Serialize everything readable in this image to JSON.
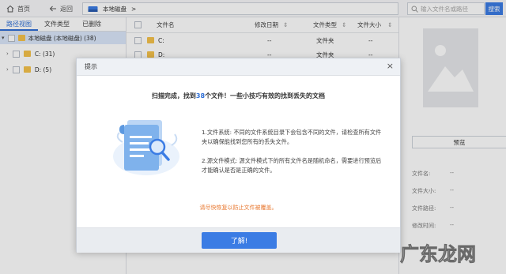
{
  "topbar": {
    "home_label": "首页",
    "back_label": "返回",
    "path": "本地磁盘",
    "path_sep": ">",
    "search_placeholder": "输入文件名或路径",
    "search_button": "搜索"
  },
  "left": {
    "tabs": [
      {
        "label": "路径视图"
      },
      {
        "label": "文件类型"
      },
      {
        "label": "已删除"
      }
    ],
    "tree": [
      {
        "label": "本地磁盘 (本地磁盘) (38)"
      },
      {
        "label": "C: (31)"
      },
      {
        "label": "D: (5)"
      }
    ]
  },
  "filelist": {
    "headers": {
      "name": "文件名",
      "date": "修改日期",
      "type": "文件类型",
      "size": "文件大小"
    },
    "rows": [
      {
        "name": "C:",
        "date": "--",
        "type": "文件夹",
        "size": "--"
      },
      {
        "name": "D:",
        "date": "--",
        "type": "文件夹",
        "size": "--"
      }
    ]
  },
  "right": {
    "preview_button": "预览",
    "fields": [
      {
        "label": "文件名:",
        "value": "--"
      },
      {
        "label": "文件大小:",
        "value": "--"
      },
      {
        "label": "文件路径:",
        "value": "--"
      },
      {
        "label": "修改时间:",
        "value": "--"
      }
    ]
  },
  "dialog": {
    "title": "提示",
    "close": "×",
    "scan_prefix": "扫描完成，找到",
    "scan_count": "38",
    "scan_suffix": "个文件！一些小技巧有效的找到丢失的文档",
    "tip1": "1.文件系统: 不同的文件系统目录下会包含不同的文件，请检查所有文件夹以确保能找到您所有的丢失文件。",
    "tip2": "2.源文件模式: 源文件模式下的所有文件名是随机命名，需要进行预览后才能确认是否是正确的文件。",
    "warning": "请尽快恢复以防止文件被覆盖。",
    "ok_button": "了解!"
  },
  "watermark": "广东龙网",
  "colors": {
    "accent": "#3b7ce4",
    "warning": "#e8772e",
    "folder": "#f5c24b"
  }
}
